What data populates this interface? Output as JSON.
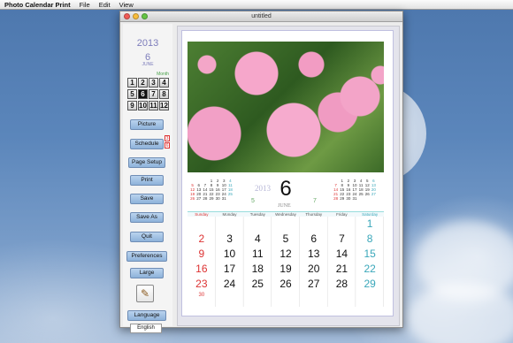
{
  "menubar": {
    "app": "Photo Calendar Print",
    "items": [
      "File",
      "Edit",
      "View"
    ]
  },
  "window": {
    "title": "untitled"
  },
  "sidebar": {
    "year": "2013",
    "month_number": "6",
    "month_name": "JUNE",
    "month_label": "Month",
    "months": [
      "1",
      "2",
      "3",
      "4",
      "5",
      "6",
      "7",
      "8",
      "9",
      "10",
      "11",
      "12"
    ],
    "selected_month": "6",
    "buttons": {
      "picture": "Picture",
      "schedule": "Schedule",
      "page_setup": "Page Setup",
      "print": "Print",
      "save": "Save",
      "save_as": "Save As",
      "quit": "Quit",
      "preferences": "Preferences",
      "large": "Large",
      "language": "Language"
    },
    "schedule_markers": [
      "3",
      "6"
    ],
    "language_value": "English"
  },
  "calendar": {
    "year_watermark": "2013",
    "month": "6",
    "month_name": "JUNE",
    "prev_month": "5",
    "prev_mini": [
      "",
      "",
      "",
      "1",
      "2",
      "3",
      "4",
      "5",
      "6",
      "7",
      "8",
      "9",
      "10",
      "11",
      "12",
      "13",
      "14",
      "15",
      "16",
      "17",
      "18",
      "19",
      "20",
      "21",
      "22",
      "23",
      "24",
      "25",
      "26",
      "27",
      "28",
      "29",
      "30",
      "31",
      ""
    ],
    "next_month": "7",
    "next_mini": [
      "",
      "1",
      "2",
      "3",
      "4",
      "5",
      "6",
      "7",
      "8",
      "9",
      "10",
      "11",
      "12",
      "13",
      "14",
      "15",
      "16",
      "17",
      "18",
      "19",
      "20",
      "21",
      "22",
      "23",
      "24",
      "25",
      "26",
      "27",
      "28",
      "29",
      "30",
      "31",
      "",
      "",
      ""
    ],
    "weekdays": [
      "Sunday",
      "Monday",
      "Tuesday",
      "Wednesday",
      "Thursday",
      "Friday",
      "Saturday"
    ],
    "days": [
      "",
      "",
      "",
      "",
      "",
      "",
      "1",
      "2",
      "3",
      "4",
      "5",
      "6",
      "7",
      "8",
      "9",
      "10",
      "11",
      "12",
      "13",
      "14",
      "15",
      "16",
      "17",
      "18",
      "19",
      "20",
      "21",
      "22",
      "23",
      "24",
      "25",
      "26",
      "27",
      "28",
      "29",
      "30",
      "",
      "",
      "",
      "",
      "",
      ""
    ]
  },
  "colors": {
    "sunday": "#dd3333",
    "saturday": "#3aa7ba",
    "month_label": "#4aa24a",
    "button": "#9dbde2"
  }
}
